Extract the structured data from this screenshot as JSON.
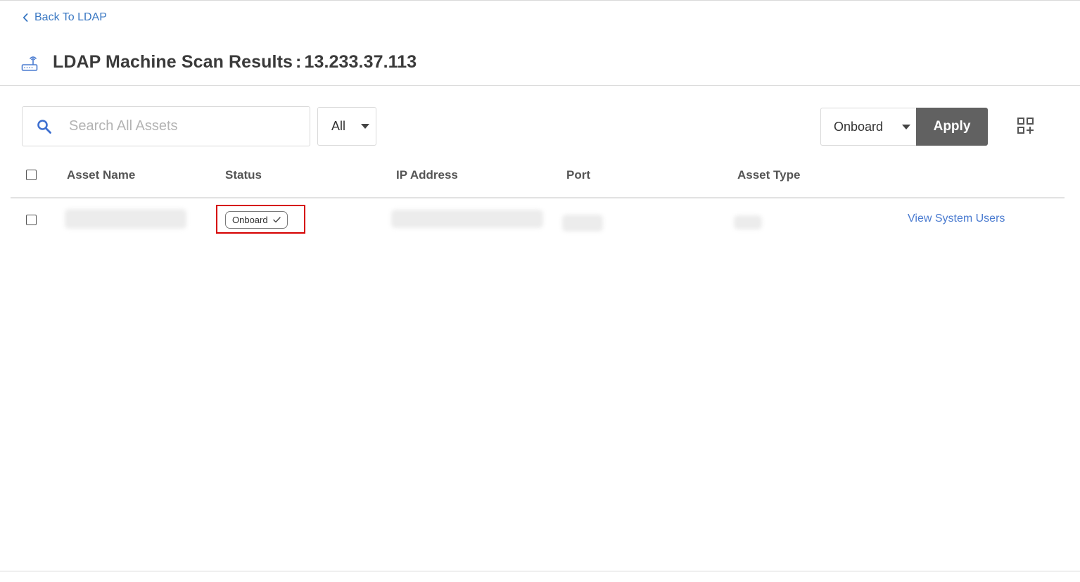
{
  "nav": {
    "back_label": "Back To LDAP"
  },
  "page": {
    "title": "LDAP Machine Scan Results",
    "title_separator": ":",
    "host_ip": "13.233.37.113"
  },
  "toolbar": {
    "search_placeholder": "Search All Assets",
    "search_value": "",
    "filter_value": "All",
    "action_value": "Onboard",
    "apply_label": "Apply"
  },
  "table": {
    "columns": [
      "Asset Name",
      "Status",
      "IP Address",
      "Port",
      "Asset Type"
    ],
    "rows": [
      {
        "asset_name": "",
        "status": "Onboard",
        "ip_address": "",
        "port": "",
        "asset_type": "",
        "action_label": "View System Users"
      }
    ]
  },
  "colors": {
    "link": "#3a78c3",
    "apply_bg": "#616161",
    "highlight": "#d50000"
  },
  "icons": {
    "back": "chevron-left-icon",
    "header": "network-device-icon",
    "search": "search-icon",
    "grid_add": "grid-add-icon",
    "status_check": "check-icon"
  }
}
